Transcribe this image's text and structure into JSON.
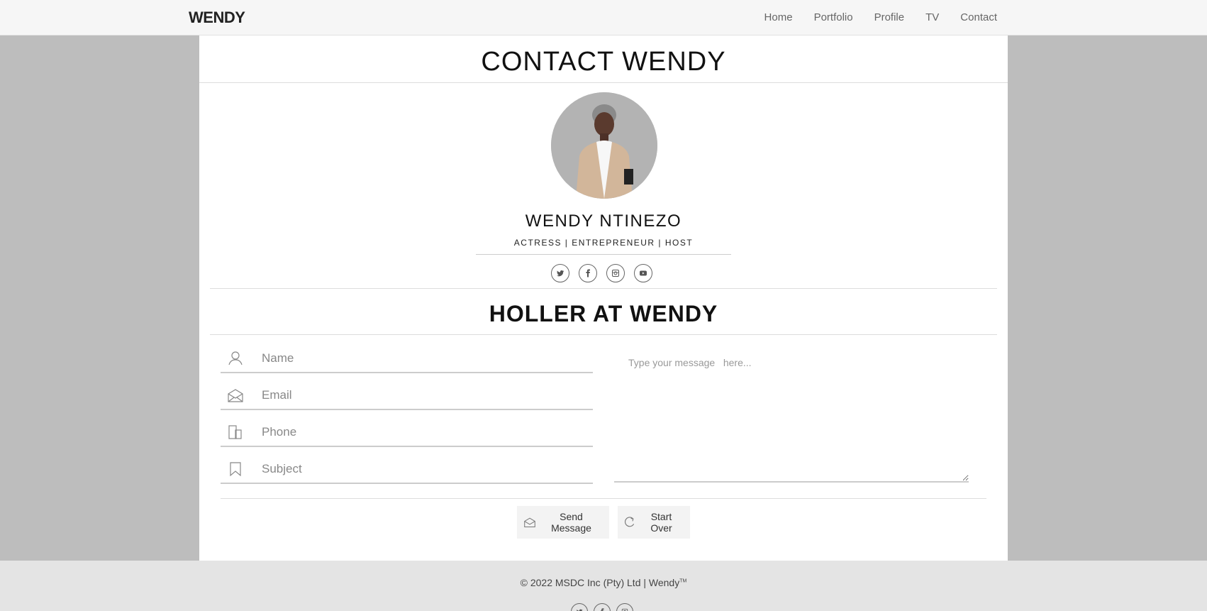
{
  "nav": {
    "brand": "WENDY",
    "links": [
      "Home",
      "Portfolio",
      "Profile",
      "TV",
      "Contact"
    ]
  },
  "page": {
    "title": "CONTACT WENDY"
  },
  "profile": {
    "name": "WENDY NTINEZO",
    "role": "ACTRESS | ENTREPRENEUR | HOST",
    "socials": [
      "twitter-icon",
      "facebook-icon",
      "instagram-icon",
      "youtube-icon"
    ]
  },
  "form": {
    "title": "HOLLER AT WENDY",
    "name_placeholder": "Name",
    "email_placeholder": "Email",
    "phone_placeholder": "Phone",
    "subject_placeholder": "Subject",
    "message_placeholder": "Type your message   here...",
    "send_label": "Send Message",
    "reset_label": "Start Over"
  },
  "footer": {
    "copyright": "© 2022 MSDC Inc (Pty) Ltd | Wendy",
    "tm": "TM",
    "socials": [
      "twitter-icon",
      "facebook-icon",
      "instagram-icon"
    ]
  }
}
